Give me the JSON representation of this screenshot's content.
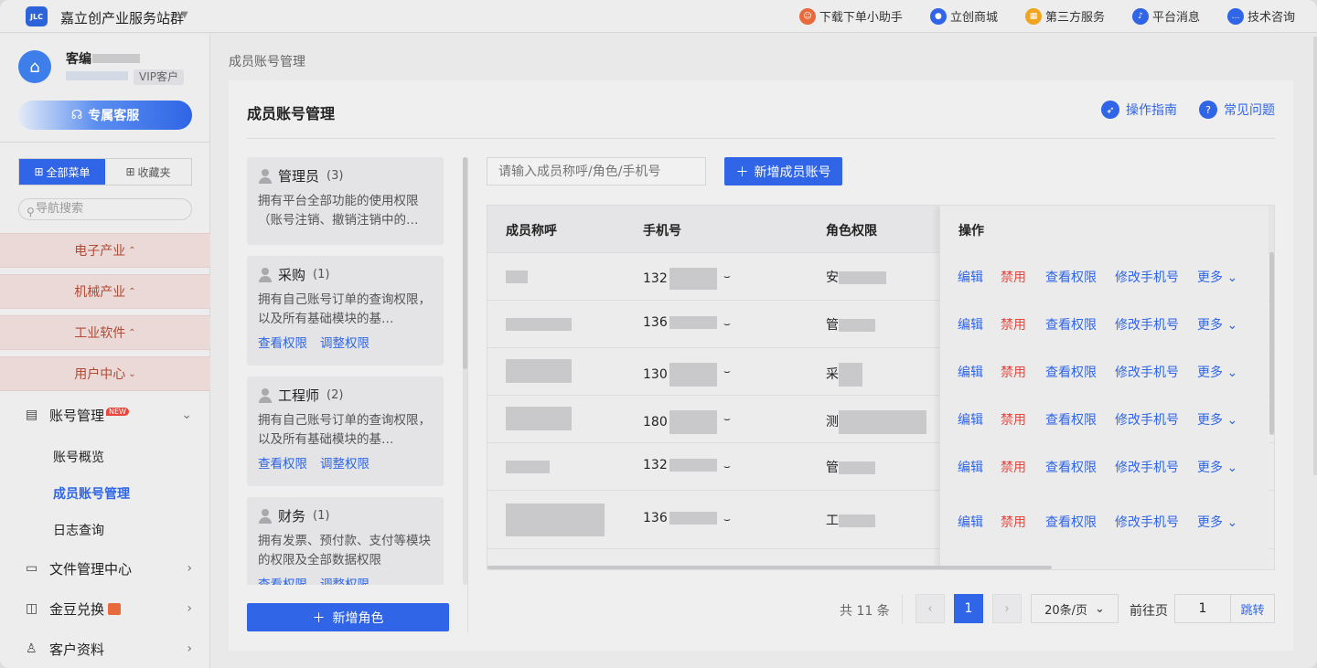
{
  "topbar": {
    "logo_text": "JLC",
    "app_title": "嘉立创产业服务站群",
    "links": [
      {
        "label": "下载下单小助手",
        "icon": "assistant-icon",
        "color": "#e86a3c"
      },
      {
        "label": "立创商城",
        "icon": "mall-icon",
        "color": "#2f65e6"
      },
      {
        "label": "第三方服务",
        "icon": "apps-icon",
        "color": "#f0a420"
      },
      {
        "label": "平台消息",
        "icon": "bell-icon",
        "color": "#2f65e6"
      },
      {
        "label": "技术咨询",
        "icon": "chat-icon",
        "color": "#2f65e6"
      }
    ]
  },
  "sidebar": {
    "user_name": "客编",
    "vip_label": "VIP客户",
    "user_sub_suffix": "…",
    "service_button": "专属客服",
    "tab_all": "全部菜单",
    "tab_fav": "收藏夹",
    "search_placeholder": "导航搜索",
    "categories": [
      "电子产业",
      "机械产业",
      "工业软件",
      "用户中心"
    ],
    "account_mgmt": "账号管理",
    "new_badge": "NEW",
    "sub_items": [
      "账号概览",
      "成员账号管理",
      "日志查询"
    ],
    "file_center": "文件管理中心",
    "beans": "金豆兑换",
    "customer_info": "客户资料"
  },
  "breadcrumb": "成员账号管理",
  "panel": {
    "title": "成员账号管理",
    "guide": "操作指南",
    "faq": "常见问题"
  },
  "roles": [
    {
      "name": "管理员",
      "count": "(3)",
      "desc": "拥有平台全部功能的使用权限（账号注销、撤销注销中的…",
      "actions": []
    },
    {
      "name": "采购",
      "count": "(1)",
      "desc": "拥有自己账号订单的查询权限，以及所有基础模块的基…",
      "actions": [
        "查看权限",
        "调整权限"
      ]
    },
    {
      "name": "工程师",
      "count": "(2)",
      "desc": "拥有自己账号订单的查询权限，以及所有基础模块的基…",
      "actions": [
        "查看权限",
        "调整权限"
      ]
    },
    {
      "name": "财务",
      "count": "(1)",
      "desc": "拥有发票、预付款、支付等模块的权限及全部数据权限",
      "actions": [
        "查看权限",
        "调整权限"
      ]
    }
  ],
  "add_role": "新增角色",
  "member_search_placeholder": "请输入成员称呼/角色/手机号",
  "add_member": "新增成员账号",
  "table": {
    "headers": [
      "成员称呼",
      "手机号",
      "角色权限",
      "操作"
    ],
    "rows": [
      {
        "phone_prefix": "132",
        "role_char": "安"
      },
      {
        "phone_prefix": "136",
        "role_char": "管"
      },
      {
        "phone_prefix": "130",
        "role_char": "采"
      },
      {
        "phone_prefix": "180",
        "role_char": "测"
      },
      {
        "phone_prefix": "132",
        "role_char": "管"
      },
      {
        "phone_prefix": "136",
        "role_char": "工"
      }
    ],
    "ops": {
      "edit": "编辑",
      "disable": "禁用",
      "view": "查看权限",
      "phone": "修改手机号",
      "more": "更多"
    }
  },
  "pagination": {
    "total": "共 11 条",
    "current": "1",
    "page_size": "20条/页",
    "goto_label": "前往页",
    "goto_value": "1",
    "jump": "跳转"
  }
}
